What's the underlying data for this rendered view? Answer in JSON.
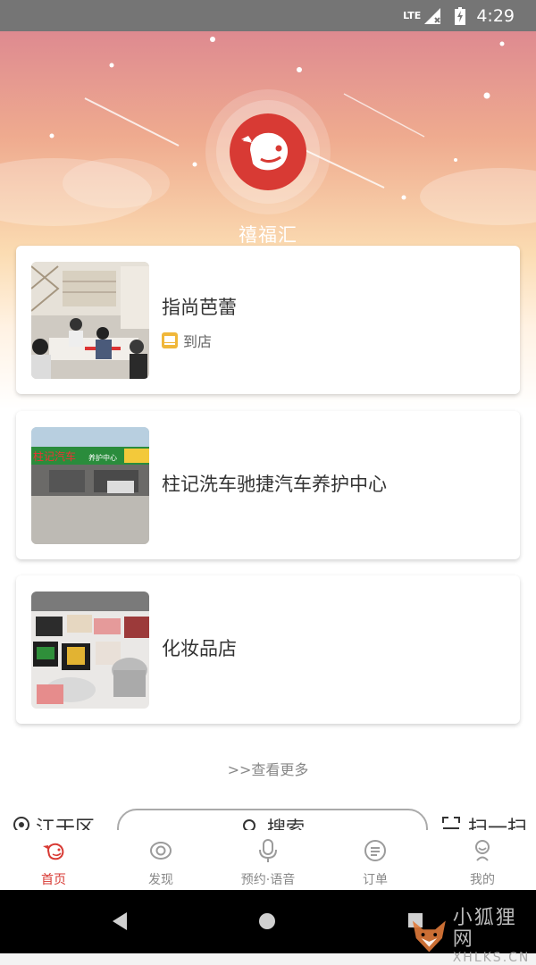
{
  "status_bar": {
    "network": "LTE",
    "time": "4:29"
  },
  "brand": {
    "name": "禧福汇",
    "accent": "#d83a34"
  },
  "stores": [
    {
      "name": "指尚芭蕾",
      "tag": "到店"
    },
    {
      "name": "柱记洗车驰捷汽车养护中心",
      "sign_text": "柱记汽车",
      "sign_sub": "养护中心"
    },
    {
      "name": "化妆品店"
    }
  ],
  "more_link": ">>查看更多",
  "search_row": {
    "location": "江干区",
    "search": "搜索",
    "scan": "扫一扫"
  },
  "tabs": [
    {
      "label": "首页",
      "icon": "whale-home-icon",
      "active": true
    },
    {
      "label": "发现",
      "icon": "eye-discover-icon"
    },
    {
      "label": "预约·语音",
      "icon": "microphone-icon"
    },
    {
      "label": "订单",
      "icon": "order-list-icon"
    },
    {
      "label": "我的",
      "icon": "profile-icon"
    }
  ],
  "watermark": {
    "title": "小狐狸网",
    "url": "XHLKS.CN"
  }
}
